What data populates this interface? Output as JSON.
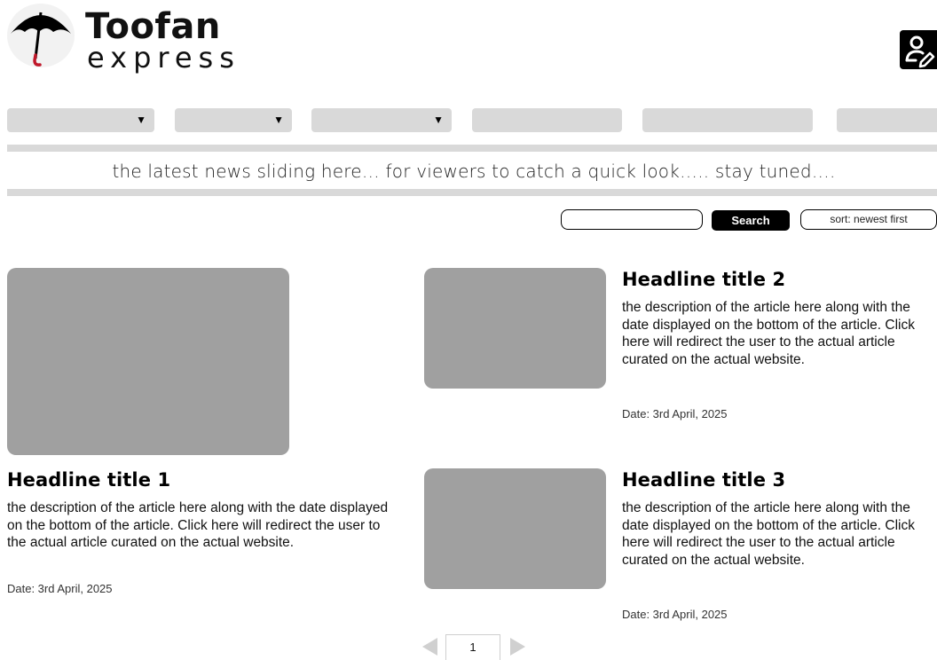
{
  "brand": {
    "title": "Toofan",
    "subtitle": "express"
  },
  "header": {
    "profile_icon": "user-edit-icon"
  },
  "nav": {
    "items": [
      {
        "label": "",
        "has_dropdown": true
      },
      {
        "label": "",
        "has_dropdown": true
      },
      {
        "label": "",
        "has_dropdown": true
      },
      {
        "label": "",
        "has_dropdown": false
      },
      {
        "label": "",
        "has_dropdown": false
      },
      {
        "label": "",
        "has_dropdown": false
      }
    ],
    "dropdown_glyph": "▼"
  },
  "ticker": {
    "text": "the latest news sliding here… for viewers to catch a quick look….. stay tuned…."
  },
  "search": {
    "value": "",
    "placeholder": "",
    "button_label": "Search",
    "sort_label": "sort: newest first"
  },
  "articles": [
    {
      "title": "Headline title 1",
      "description": "the description of the article here along with the date displayed on the bottom of the article. Click here will redirect the user to the actual article curated on the actual website.",
      "date": "Date: 3rd April, 2025"
    },
    {
      "title": "Headline title 2",
      "description": "the description of the article here along with the date displayed on the bottom of the article. Click here will redirect the user to the actual article curated on the actual website.",
      "date": "Date: 3rd April, 2025"
    },
    {
      "title": "Headline title 3",
      "description": "the description of the article here along with the date displayed on the bottom of the article. Click here will redirect the user to the actual article curated on the actual website.",
      "date": "Date: 3rd April, 2025"
    }
  ],
  "pagination": {
    "current_page": "1"
  },
  "colors": {
    "placeholder_gray": "#a0a0a0",
    "nav_gray": "#d9d9d9",
    "accent_black": "#000000",
    "umbrella_handle_red": "#c0182a"
  }
}
